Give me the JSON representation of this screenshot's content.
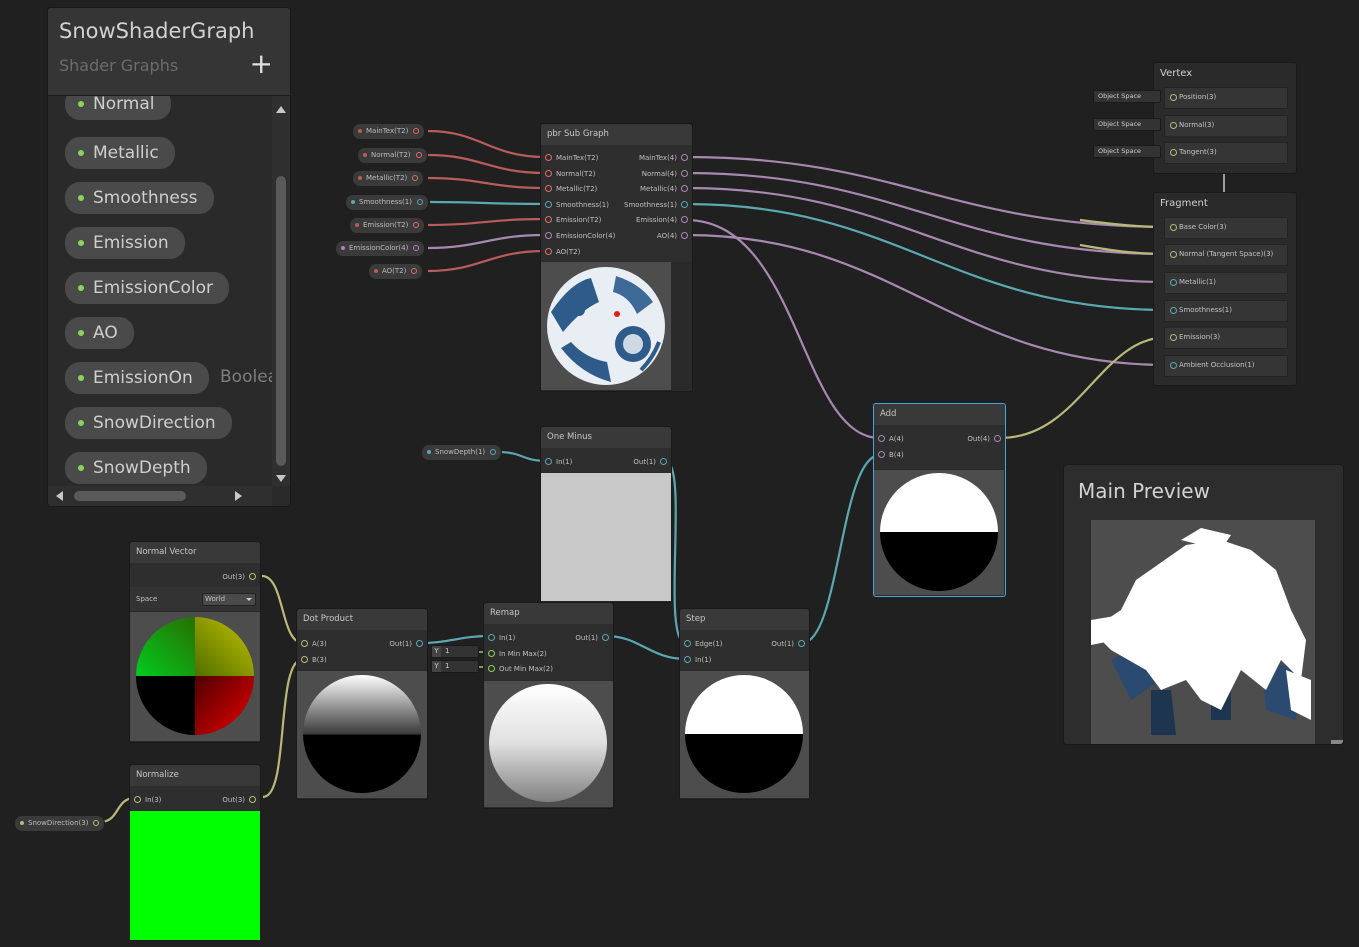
{
  "blackboard": {
    "title": "SnowShaderGraph",
    "subtitle": "Shader Graphs",
    "add_icon": "+",
    "properties": [
      "Normal",
      "Metallic",
      "Smoothness",
      "Emission",
      "EmissionColor",
      "AO",
      "EmissionOn",
      "SnowDirection",
      "SnowDepth"
    ],
    "emission_on_type": "Boolea"
  },
  "property_nodes": {
    "maintex": "MainTex(T2)",
    "normal": "Normal(T2)",
    "metallic": "Metallic(T2)",
    "smoothness": "Smoothness(1)",
    "emission": "Emission(T2)",
    "emissioncolor": "EmissionColor(4)",
    "ao": "AO(T2)",
    "snowdepth": "SnowDepth(1)",
    "snowdirection": "SnowDirection(3)"
  },
  "pbr_subgraph": {
    "title": "pbr Sub Graph",
    "inputs": [
      "MainTex(T2)",
      "Normal(T2)",
      "Metallic(T2)",
      "Smoothness(1)",
      "Emission(T2)",
      "EmissionColor(4)",
      "AO(T2)"
    ],
    "outputs": [
      "MainTex(4)",
      "Normal(4)",
      "Metallic(4)",
      "Smoothness(1)",
      "Emission(4)",
      "AO(4)"
    ]
  },
  "vertex": {
    "title": "Vertex",
    "space_label": "Object Space",
    "ports": [
      "Position(3)",
      "Normal(3)",
      "Tangent(3)"
    ]
  },
  "fragment": {
    "title": "Fragment",
    "ports": [
      "Base Color(3)",
      "Normal (Tangent Space)(3)",
      "Metallic(1)",
      "Smoothness(1)",
      "Emission(3)",
      "Ambient Occlusion(1)"
    ]
  },
  "one_minus": {
    "title": "One Minus",
    "in": "In(1)",
    "out": "Out(1)"
  },
  "add": {
    "title": "Add",
    "a": "A(4)",
    "b": "B(4)",
    "out": "Out(4)"
  },
  "normal_vector": {
    "title": "Normal Vector",
    "out": "Out(3)",
    "space_label": "Space",
    "space_value": "World"
  },
  "normalize": {
    "title": "Normalize",
    "in": "In(3)",
    "out": "Out(3)"
  },
  "dot_product": {
    "title": "Dot Product",
    "a": "A(3)",
    "b": "B(3)",
    "out": "Out(1)"
  },
  "remap": {
    "title": "Remap",
    "in": "In(1)",
    "in_min_max": "In Min Max(2)",
    "out_min_max": "Out Min Max(2)",
    "out": "Out(1)",
    "y_label": "Y",
    "y1": "1",
    "y2": "1"
  },
  "step": {
    "title": "Step",
    "edge": "Edge(1)",
    "in": "In(1)",
    "out": "Out(1)"
  },
  "main_preview": {
    "title": "Main Preview"
  },
  "colors": {
    "accent_blue": "#44a8e0",
    "wire_red": "#b85c5c",
    "wire_teal": "#5aa8b0",
    "wire_purple": "#a888b0",
    "wire_olive": "#b8b87a",
    "bool_green": "#8bd35b"
  }
}
